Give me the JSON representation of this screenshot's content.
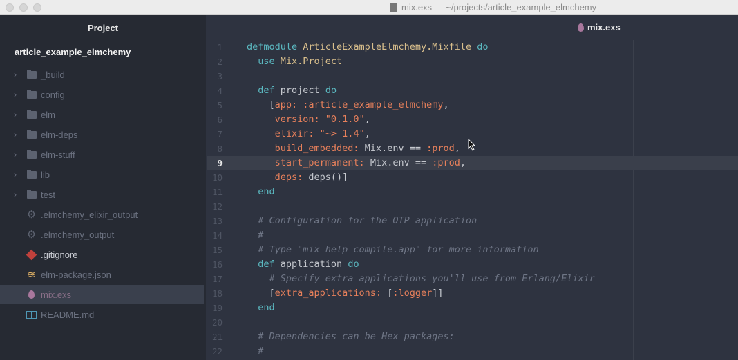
{
  "window": {
    "title": "mix.exs — ~/projects/article_example_elmchemy"
  },
  "sidebar": {
    "title": "Project",
    "root": "article_example_elmchemy",
    "items": [
      {
        "label": "_build",
        "icon": "folder-icon",
        "expandable": true
      },
      {
        "label": "config",
        "icon": "folder-icon",
        "expandable": true
      },
      {
        "label": "elm",
        "icon": "folder-icon",
        "expandable": true
      },
      {
        "label": "elm-deps",
        "icon": "folder-icon",
        "expandable": true
      },
      {
        "label": "elm-stuff",
        "icon": "folder-icon",
        "expandable": true
      },
      {
        "label": "lib",
        "icon": "folder-icon",
        "expandable": true
      },
      {
        "label": "test",
        "icon": "folder-icon",
        "expandable": true
      },
      {
        "label": ".elmchemy_elixir_output",
        "icon": "gear-icon"
      },
      {
        "label": ".elmchemy_output",
        "icon": "gear-icon"
      },
      {
        "label": ".gitignore",
        "icon": "git-icon"
      },
      {
        "label": "elm-package.json",
        "icon": "database-icon"
      },
      {
        "label": "mix.exs",
        "icon": "elixir-drop-icon",
        "selected": true
      },
      {
        "label": "README.md",
        "icon": "book-icon"
      }
    ]
  },
  "editor": {
    "tab": "mix.exs",
    "current_line": 9,
    "lines": [
      [
        [
          "kw",
          "defmodule "
        ],
        [
          "mod",
          "ArticleExampleElmchemy.Mixfile "
        ],
        [
          "kw",
          "do"
        ]
      ],
      [
        [
          "kw",
          "  use "
        ],
        [
          "mod",
          "Mix.Project"
        ]
      ],
      [],
      [
        [
          "kw",
          "  def "
        ],
        [
          "id",
          "project "
        ],
        [
          "kw",
          "do"
        ]
      ],
      [
        [
          "op",
          "    ["
        ],
        [
          "atom",
          "app: :article_example_elmchemy"
        ],
        [
          "op",
          ","
        ]
      ],
      [
        [
          "atom",
          "     version: "
        ],
        [
          "str",
          "\"0.1.0\""
        ],
        [
          "op",
          ","
        ]
      ],
      [
        [
          "atom",
          "     elixir: "
        ],
        [
          "str",
          "\"~> 1.4\""
        ],
        [
          "op",
          ","
        ]
      ],
      [
        [
          "atom",
          "     build_embedded: "
        ],
        [
          "id",
          "Mix.env == "
        ],
        [
          "atom",
          ":prod"
        ],
        [
          "op",
          ","
        ]
      ],
      [
        [
          "atom",
          "     start_permanent: "
        ],
        [
          "id",
          "Mix.env == "
        ],
        [
          "atom",
          ":prod"
        ],
        [
          "op",
          ","
        ]
      ],
      [
        [
          "atom",
          "     deps: "
        ],
        [
          "id",
          "deps()]"
        ]
      ],
      [
        [
          "kw",
          "  end"
        ]
      ],
      [],
      [
        [
          "cm",
          "  # Configuration for the OTP application"
        ]
      ],
      [
        [
          "cm",
          "  #"
        ]
      ],
      [
        [
          "cm",
          "  # Type \"mix help compile.app\" for more information"
        ]
      ],
      [
        [
          "kw",
          "  def "
        ],
        [
          "id",
          "application "
        ],
        [
          "kw",
          "do"
        ]
      ],
      [
        [
          "cm",
          "    # Specify extra applications you'll use from Erlang/Elixir"
        ]
      ],
      [
        [
          "op",
          "    ["
        ],
        [
          "atom",
          "extra_applications: "
        ],
        [
          "op",
          "["
        ],
        [
          "atom",
          ":logger"
        ],
        [
          "op",
          "]]"
        ]
      ],
      [
        [
          "kw",
          "  end"
        ]
      ],
      [],
      [
        [
          "cm",
          "  # Dependencies can be Hex packages:"
        ]
      ],
      [
        [
          "cm",
          "  #"
        ]
      ]
    ]
  },
  "colors": {
    "accent": "#a8779c",
    "keyword": "#5bb8c0",
    "atom": "#e7805b",
    "module": "#d9bf8c"
  }
}
